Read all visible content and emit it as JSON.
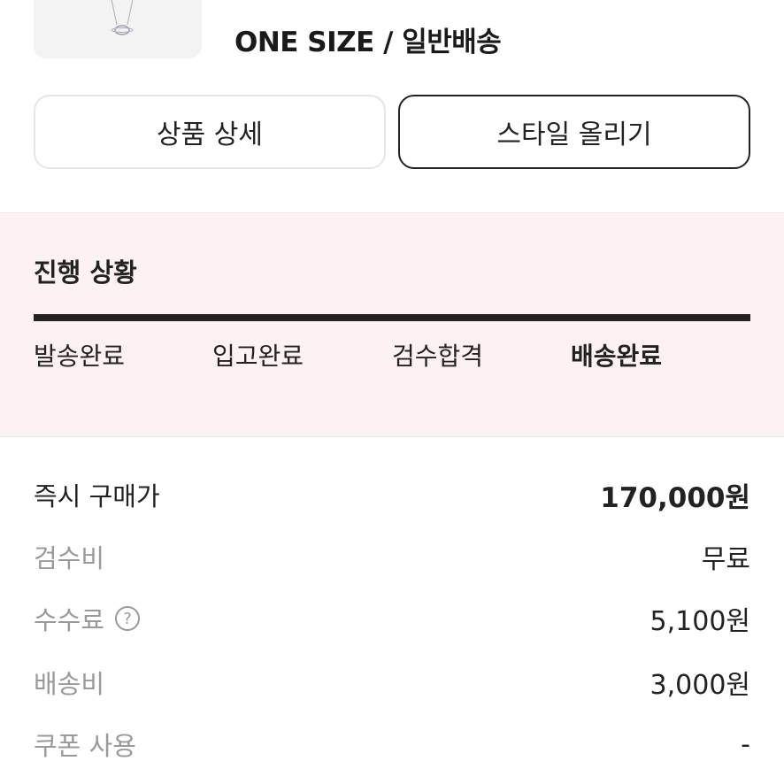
{
  "product": {
    "option": "ONE SIZE / 일반배송"
  },
  "actions": {
    "detail_label": "상품 상세",
    "style_label": "스타일 올리기"
  },
  "progress": {
    "title": "진행 상황",
    "steps": [
      {
        "label": "발송완료"
      },
      {
        "label": "입고완료"
      },
      {
        "label": "검수합격"
      },
      {
        "label": "배송완료"
      }
    ],
    "active_step": 3
  },
  "price": {
    "rows": [
      {
        "label": "즉시 구매가",
        "value": "170,000원"
      },
      {
        "label": "검수비",
        "value": "무료"
      },
      {
        "label": "수수료",
        "value": "5,100원"
      },
      {
        "label": "배송비",
        "value": "3,000원"
      },
      {
        "label": "쿠폰 사용",
        "value": "-"
      }
    ],
    "help_icon": "question-circle-icon"
  }
}
